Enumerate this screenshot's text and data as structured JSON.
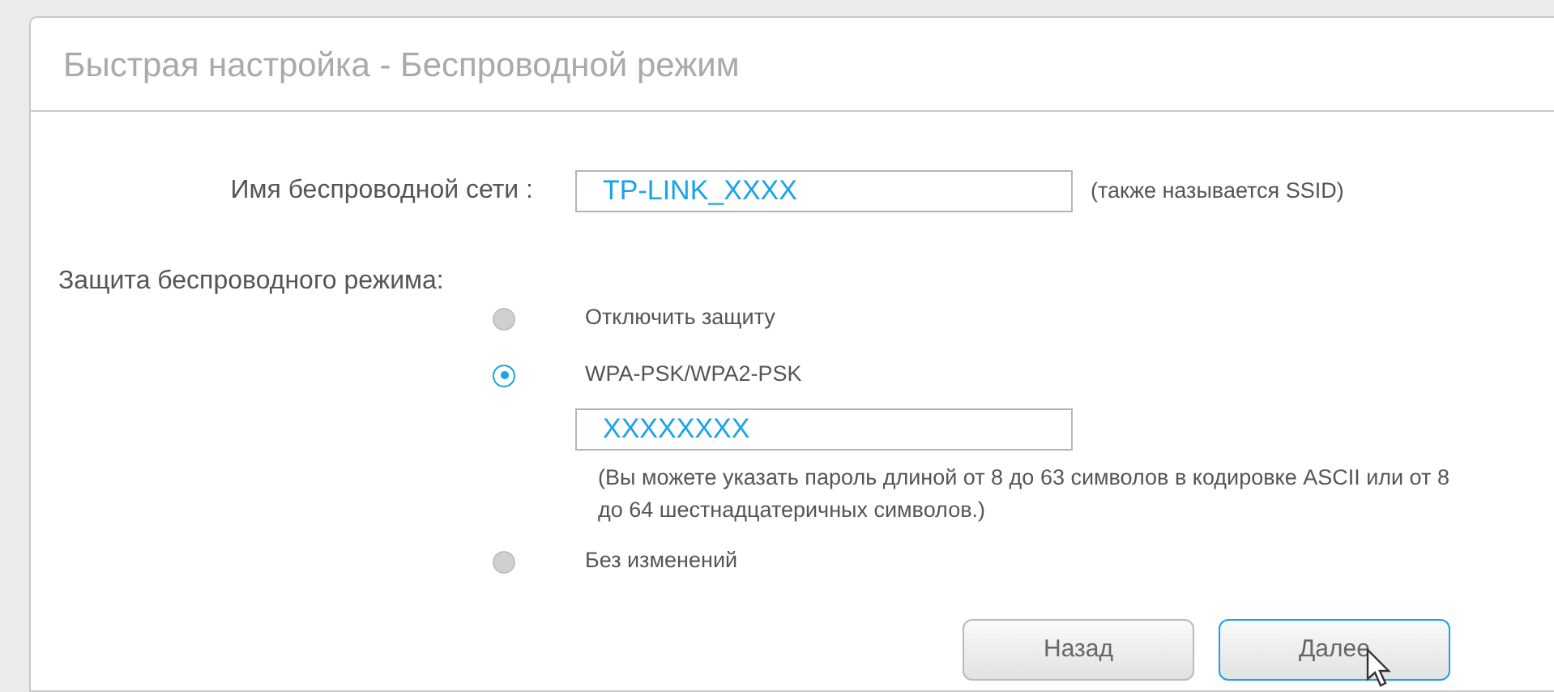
{
  "panel": {
    "title": "Быстрая настройка - Беспроводной режим"
  },
  "ssid": {
    "label": "Имя беспроводной сети :",
    "value": "TP-LINK_XXXX",
    "hint": "(также называется SSID)"
  },
  "security": {
    "label": "Защита беспроводного режима:",
    "options": [
      {
        "label": "Отключить защиту",
        "selected": false
      },
      {
        "label": "WPA-PSK/WPA2-PSK",
        "selected": true,
        "password": "XXXXXXXX",
        "note": "(Вы можете указать пароль длиной от 8 до 63 символов в кодировке ASCII или от 8 до 64 шестнадцатеричных символов.)"
      },
      {
        "label": "Без изменений",
        "selected": false
      }
    ]
  },
  "buttons": [
    {
      "label": "Назад",
      "highlighted": false
    },
    {
      "label": "Далее",
      "highlighted": true
    }
  ]
}
